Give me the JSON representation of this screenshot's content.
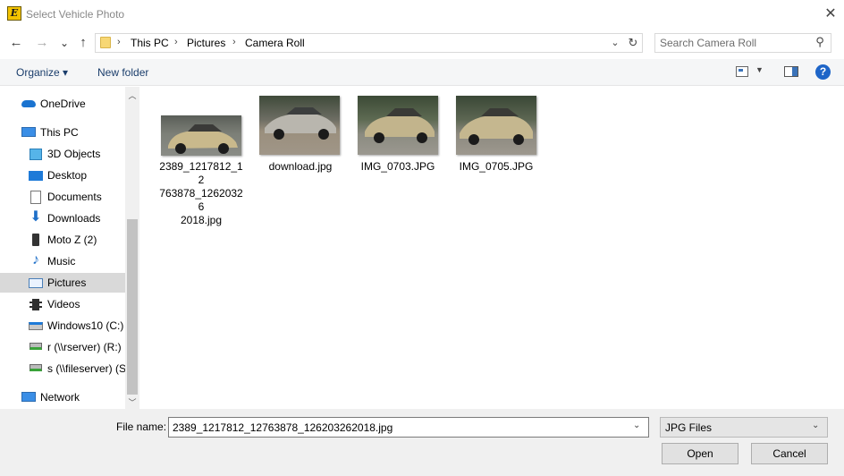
{
  "window": {
    "title": "Select Vehicle Photo",
    "app_icon_letter": "E"
  },
  "nav": {
    "back": "←",
    "forward": "→",
    "recent": "⌄",
    "up": "↑"
  },
  "address": {
    "crumbs": [
      "This PC",
      "Pictures",
      "Camera Roll"
    ],
    "separator": "›"
  },
  "search": {
    "placeholder": "Search Camera Roll"
  },
  "toolbar": {
    "organize": "Organize ▾",
    "new_folder": "New folder",
    "help": "?"
  },
  "sidebar": {
    "items": [
      {
        "label": "OneDrive",
        "icon": "cloud-icon"
      },
      {
        "label": "This PC",
        "icon": "computer-icon"
      },
      {
        "label": "3D Objects",
        "icon": "cube-icon"
      },
      {
        "label": "Desktop",
        "icon": "desktop-icon"
      },
      {
        "label": "Documents",
        "icon": "document-icon"
      },
      {
        "label": "Downloads",
        "icon": "download-icon"
      },
      {
        "label": "Moto Z (2)",
        "icon": "phone-icon"
      },
      {
        "label": "Music",
        "icon": "music-icon"
      },
      {
        "label": "Pictures",
        "icon": "pictures-icon",
        "selected": true
      },
      {
        "label": "Videos",
        "icon": "video-icon"
      },
      {
        "label": "Windows10 (C:)",
        "icon": "drive-icon"
      },
      {
        "label": "r (\\\\rserver) (R:)",
        "icon": "network-drive-icon"
      },
      {
        "label": "s (\\\\fileserver) (S",
        "icon": "network-drive-icon"
      },
      {
        "label": "Network",
        "icon": "network-icon"
      }
    ]
  },
  "files": [
    {
      "name": "2389_1217812_12763878_126203262018.jpg",
      "display": "2389_1217812_12\n763878_12620326\n2018.jpg"
    },
    {
      "name": "download.jpg",
      "display": "download.jpg"
    },
    {
      "name": "IMG_0703.JPG",
      "display": "IMG_0703.JPG"
    },
    {
      "name": "IMG_0705.JPG",
      "display": "IMG_0705.JPG"
    }
  ],
  "footer": {
    "file_name_label": "File name:",
    "file_name_value": "2389_1217812_12763878_126203262018.jpg",
    "filter_value": "JPG Files",
    "open_label": "Open",
    "cancel_label": "Cancel"
  },
  "colors": {
    "accent": "#1e65c8",
    "selection": "#d9d9d9",
    "link": "#1a3d6b"
  }
}
